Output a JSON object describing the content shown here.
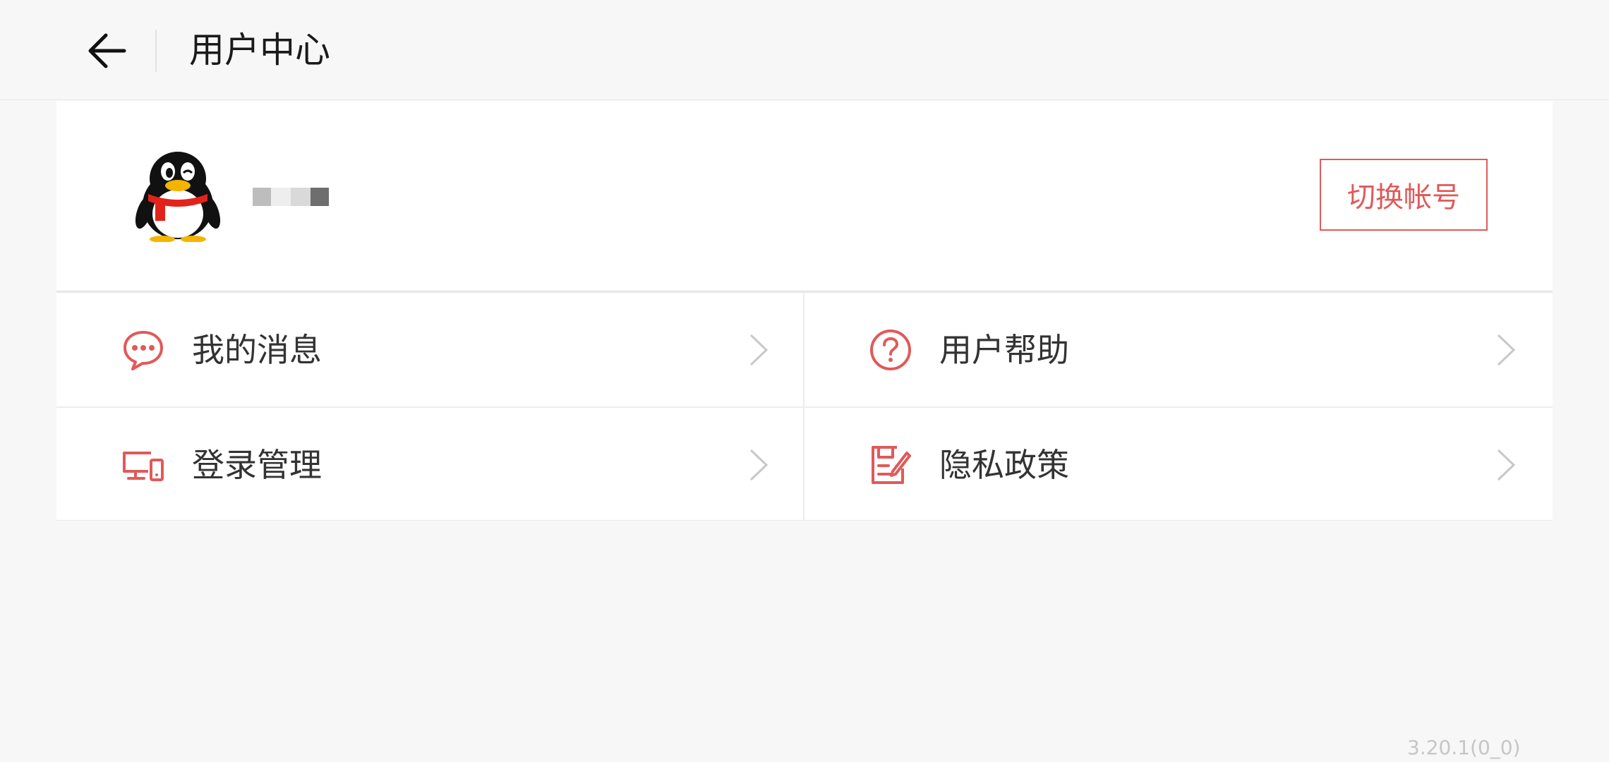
{
  "header": {
    "back_icon": "arrow-left-icon",
    "title": "用户中心"
  },
  "profile": {
    "avatar_icon": "qq-penguin-avatar",
    "username_masked": "",
    "switch_account_label": "切换帐号"
  },
  "menu": {
    "items": [
      {
        "label": "我的消息",
        "icon": "message-bubble-icon"
      },
      {
        "label": "用户帮助",
        "icon": "question-circle-icon"
      },
      {
        "label": "登录管理",
        "icon": "devices-icon"
      },
      {
        "label": "隐私政策",
        "icon": "privacy-document-icon"
      }
    ],
    "chevron_icon": "chevron-right-icon"
  },
  "footer": {
    "version": "3.20.1(0_0)"
  },
  "colors": {
    "accent": "#e05a5a",
    "background": "#f7f7f7",
    "card": "#ffffff",
    "text_primary": "#1a1a1a",
    "text_secondary": "#333333",
    "divider": "#ececec",
    "version_text": "#c6c6c6"
  }
}
